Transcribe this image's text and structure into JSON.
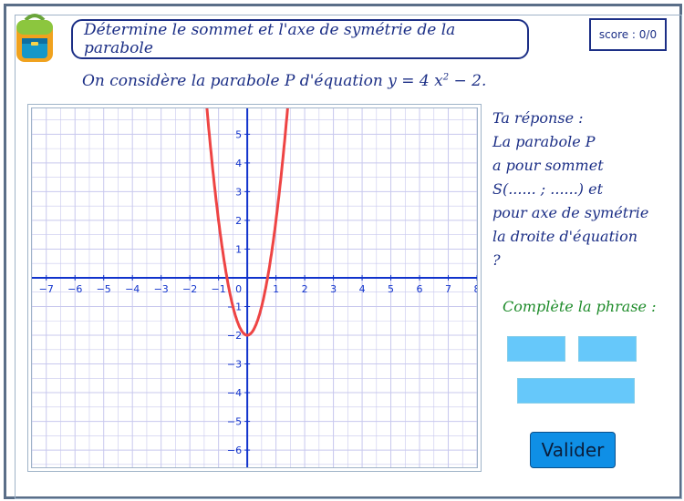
{
  "title": "Détermine le sommet et l'axe de symétrie de la parabole",
  "score": "score : 0/0",
  "statement": {
    "prefix": "On considère la parabole P d'équation y = 4 x",
    "exponent": "2",
    "suffix": " − 2."
  },
  "answer_lines": [
    "Ta réponse :",
    "La parabole P",
    "a pour sommet",
    "S(...... ;  ......) et",
    "pour axe de symétrie",
    "la droite d'équation",
    "?"
  ],
  "complete_label": "Complète la phrase :",
  "validate_label": "Valider",
  "colors": {
    "accent": "#1c2f86",
    "curve": "#ee4444",
    "axis": "#1133cc",
    "grid": "#c8c8ee",
    "field": "#66c8fa",
    "button": "#0f8fe6",
    "green": "#1f8c2b"
  },
  "chart_data": {
    "type": "line",
    "function": "y = 4x^2 - 2",
    "x_ticks": [
      -7,
      -6,
      -5,
      -4,
      -3,
      -2,
      -1,
      1,
      2,
      3,
      4,
      5,
      6,
      7,
      8
    ],
    "y_ticks": [
      -6,
      -5,
      -4,
      -3,
      -2,
      -1,
      1,
      2,
      3,
      4,
      5
    ],
    "origin_label": "0",
    "xlim": [
      -7.5,
      8
    ],
    "ylim": [
      -6.6,
      5.9
    ],
    "grid": true
  }
}
